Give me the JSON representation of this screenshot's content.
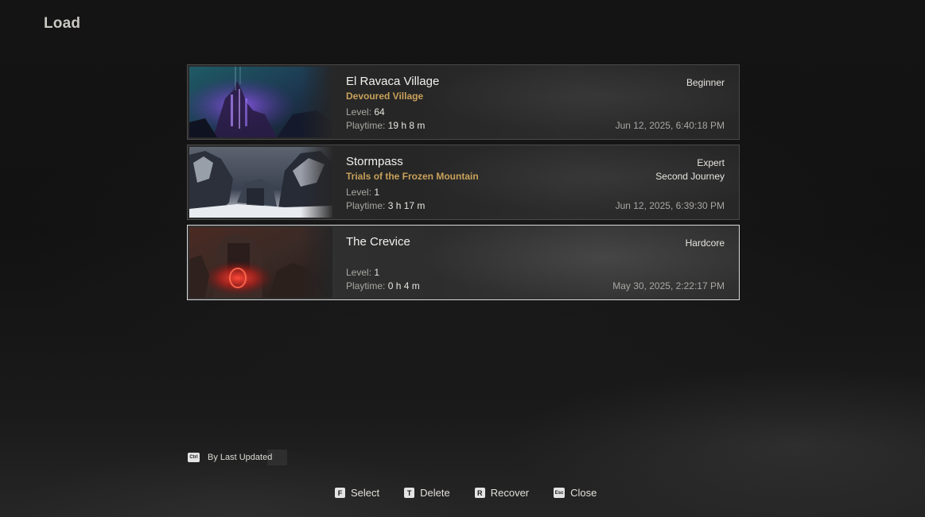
{
  "page": {
    "title": "Load"
  },
  "slots": [
    {
      "name": "El Ravaca Village",
      "subtitle": "Devoured Village",
      "level_label": "Level:",
      "level": "64",
      "playtime_label": "Playtime:",
      "playtime": "19 h 8 m",
      "difficulty": "Beginner",
      "journey": "",
      "date": "Jun 12, 2025, 6:40:18 PM",
      "thumbnail": "purple-ruins-scene"
    },
    {
      "name": "Stormpass",
      "subtitle": "Trials of the Frozen Mountain",
      "level_label": "Level:",
      "level": "1",
      "playtime_label": "Playtime:",
      "playtime": "3 h 17 m",
      "difficulty": "Expert",
      "journey": "Second Journey",
      "date": "Jun 12, 2025, 6:39:30 PM",
      "thumbnail": "snowy-mountain-scene"
    },
    {
      "name": "The Crevice",
      "subtitle": "",
      "level_label": "Level:",
      "level": "1",
      "playtime_label": "Playtime:",
      "playtime": "0 h 4 m",
      "difficulty": "Hardcore",
      "journey": "",
      "date": "May 30, 2025, 2:22:17 PM",
      "thumbnail": "red-portal-scene"
    }
  ],
  "sort": {
    "key": "Ctrl",
    "label": "By Last Updated"
  },
  "actions": [
    {
      "key": "F",
      "label": "Select"
    },
    {
      "key": "T",
      "label": "Delete"
    },
    {
      "key": "R",
      "label": "Recover"
    },
    {
      "key": "Esc",
      "label": "Close"
    }
  ],
  "colors": {
    "subtitle_gold": "#c8a15a",
    "selected_border": "#d9d9d9"
  }
}
